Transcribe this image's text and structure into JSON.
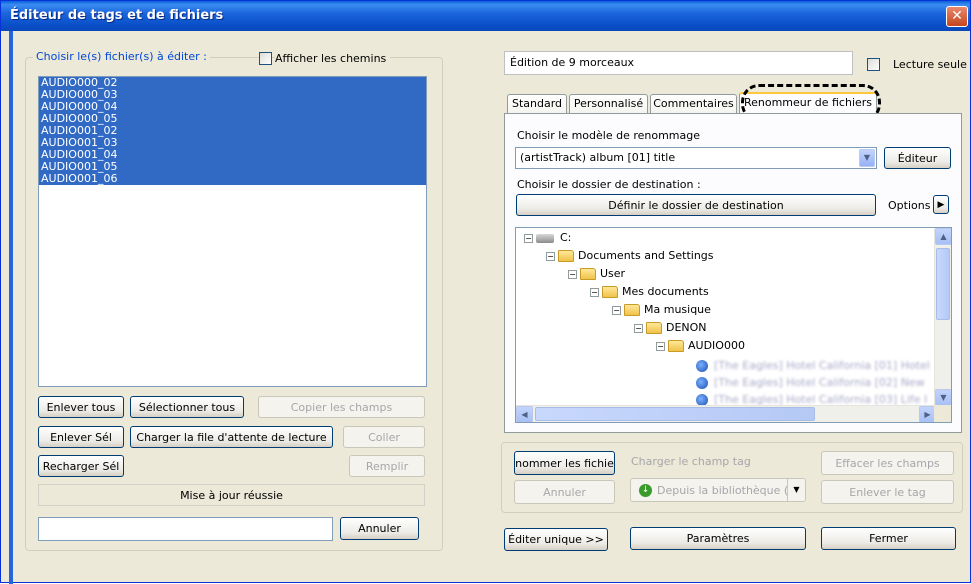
{
  "window": {
    "title": "Éditeur de tags et de fichiers",
    "close_glyph": "✕"
  },
  "left": {
    "group_label": "Choisir le(s) fichier(s) à éditer :",
    "show_paths_label": "Afficher les chemins",
    "files": [
      "AUDIO000_02",
      "AUDIO000_03",
      "AUDIO000_04",
      "AUDIO000_05",
      "AUDIO001_02",
      "AUDIO001_03",
      "AUDIO001_04",
      "AUDIO001_05",
      "AUDIO001_06"
    ],
    "buttons": {
      "remove_all": "Enlever tous",
      "select_all": "Sélectionner tous",
      "copy_fields": "Copier les champs",
      "remove_sel": "Enlever Sél",
      "load_queue": "Charger la file d'attente de lecture",
      "paste": "Coller",
      "reload_sel": "Recharger Sél",
      "fill": "Remplir",
      "cancel": "Annuler"
    },
    "status": "Mise à jour réussie",
    "input_value": ""
  },
  "right": {
    "edition_text": "Édition de 9 morceaux",
    "read_only_label": "Lecture seule",
    "tabs": [
      "Standard",
      "Personnalisé",
      "Commentaires",
      "Renommeur de fichiers"
    ],
    "active_tab": "Renommeur de fichiers",
    "choose_model_label": "Choisir le modèle de renommage",
    "model_value": "(artistTrack) album [01] title",
    "editor_button": "Éditeur",
    "choose_dest_label": "Choisir le dossier de destination :",
    "define_dest_button": "Définir le dossier de destination",
    "options_label": "Options",
    "options_arrow": "▶",
    "tree": [
      {
        "label": "C:",
        "depth": 0,
        "icon": "drive-icon",
        "expander": "−"
      },
      {
        "label": "Documents and Settings",
        "depth": 1,
        "icon": "folder-icon",
        "expander": "−"
      },
      {
        "label": "User",
        "depth": 2,
        "icon": "folder-icon",
        "expander": "−"
      },
      {
        "label": "Mes documents",
        "depth": 3,
        "icon": "folder-icon",
        "expander": "−"
      },
      {
        "label": "Ma musique",
        "depth": 4,
        "icon": "folder-icon",
        "expander": "−"
      },
      {
        "label": "DENON",
        "depth": 5,
        "icon": "folder-icon",
        "expander": "−"
      },
      {
        "label": "AUDIO000",
        "depth": 6,
        "icon": "folder-icon",
        "expander": "−"
      },
      {
        "label": "[The Eagles] Hotel California [01] Hotel",
        "depth": 7,
        "icon": "audio-file-icon",
        "expander": ""
      },
      {
        "label": "[The Eagles] Hotel California [02] New",
        "depth": 7,
        "icon": "audio-file-icon",
        "expander": ""
      },
      {
        "label": "[The Eagles] Hotel California [03] Life I",
        "depth": 7,
        "icon": "audio-file-icon",
        "expander": ""
      }
    ],
    "rename_button": "nommer les fichie",
    "load_tag_field_label": "Charger le champ tag",
    "clear_fields_button": "Effacer les champs",
    "cancel_button": "Annuler",
    "from_library_button": "Depuis la bibliothèque (",
    "remove_tag_button": "Enlever le tag",
    "edit_single_button": "Éditer unique >>",
    "settings_button": "Paramètres",
    "close_button": "Fermer"
  }
}
